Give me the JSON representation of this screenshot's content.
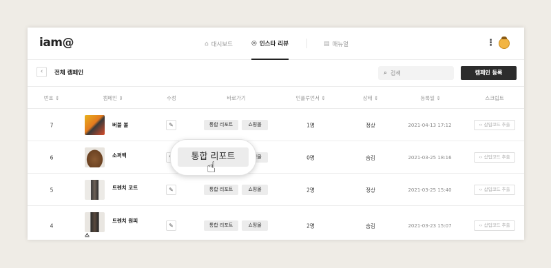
{
  "header": {
    "logo": "iam@",
    "nav": [
      {
        "label": "대시보드",
        "icon": "home-icon",
        "glyph": "⌂"
      },
      {
        "label": "인스타 리뷰",
        "icon": "instagram-icon",
        "glyph": "◎"
      },
      {
        "label": "매뉴얼",
        "icon": "book-icon",
        "glyph": "▤"
      }
    ],
    "kebab": "⋮"
  },
  "subbar": {
    "title": "전체 캠페인",
    "back": "‹",
    "search_placeholder": "검색",
    "search_icon": "⌕",
    "register_label": "캠페인 등록"
  },
  "table": {
    "headers": [
      "번호 ⇕",
      "캠페인 ⇕",
      "수정",
      "바로가기",
      "인플루언서 ⇕",
      "상태 ⇕",
      "등록일 ⇕",
      "스크립트"
    ],
    "rows": [
      {
        "no": "7",
        "name": "버블 볼",
        "name2": "",
        "influencers": "1명",
        "status": "정상",
        "date": "2021-04-13 17:12"
      },
      {
        "no": "6",
        "name": "소퍼백",
        "name2": "",
        "influencers": "0명",
        "status": "숨김",
        "date": "2021-03-25 18:16"
      },
      {
        "no": "5",
        "name": "트렌치 코트",
        "name2": "",
        "influencers": "2명",
        "status": "정상",
        "date": "2021-03-25 15:40"
      },
      {
        "no": "4",
        "name": "트렌치 원피",
        "name2": "스",
        "influencers": "2명",
        "status": "숨김",
        "date": "2021-03-23 15:07"
      }
    ],
    "chip_report": "통합 리포트",
    "chip_shop": "쇼핑몰",
    "edit_glyph": "✎",
    "script_label": "‹› 삽입코드 추출"
  },
  "popup": {
    "label": "통합 리포트",
    "cursor_glyph": "☝"
  },
  "colors": {
    "background": "#efece6",
    "button_dark": "#2c2c2c",
    "chip": "#ececec"
  }
}
